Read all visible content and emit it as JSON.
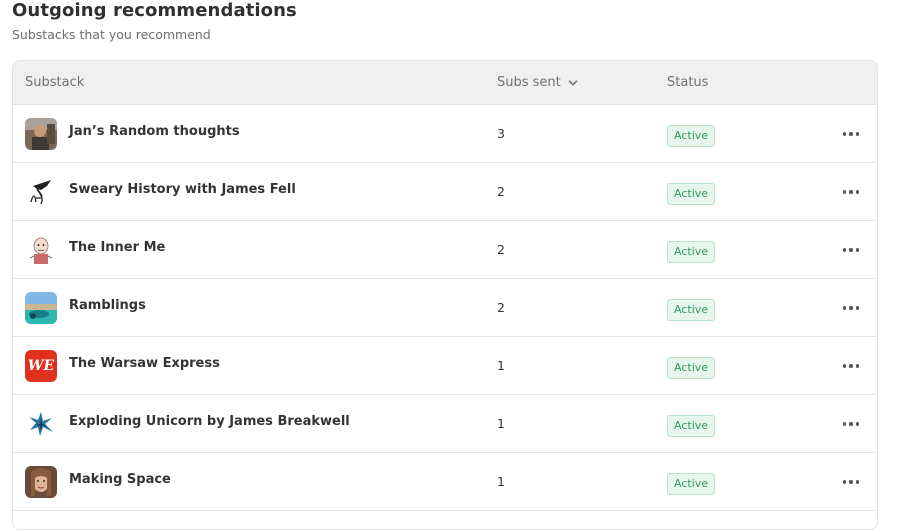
{
  "header": {
    "title": "Outgoing recommendations",
    "subtitle": "Substacks that you recommend"
  },
  "table": {
    "columns": {
      "substack": "Substack",
      "subs_sent": "Subs sent",
      "status": "Status"
    },
    "rows": [
      {
        "name": "Jan’s Random thoughts",
        "subs_sent": "3",
        "status": "Active",
        "avatar": "photo-avatar"
      },
      {
        "name": "Sweary History with James Fell",
        "subs_sent": "2",
        "status": "Active",
        "avatar": "quill-logo"
      },
      {
        "name": "The Inner Me",
        "subs_sent": "2",
        "status": "Active",
        "avatar": "cartoon-avatar"
      },
      {
        "name": "Ramblings",
        "subs_sent": "2",
        "status": "Active",
        "avatar": "landscape-photo"
      },
      {
        "name": "The Warsaw Express",
        "subs_sent": "1",
        "status": "Active",
        "avatar": "we-logo",
        "avatar_text": "WE"
      },
      {
        "name": "Exploding Unicorn by James Breakwell",
        "subs_sent": "1",
        "status": "Active",
        "avatar": "unicorn-logo"
      },
      {
        "name": "Making Space",
        "subs_sent": "1",
        "status": "Active",
        "avatar": "photo-avatar"
      }
    ]
  },
  "colors": {
    "badge_text": "#2e9a5c",
    "badge_bg": "#e6f6ec",
    "header_bg": "#f0f0f0",
    "we_red": "#e0301e"
  }
}
